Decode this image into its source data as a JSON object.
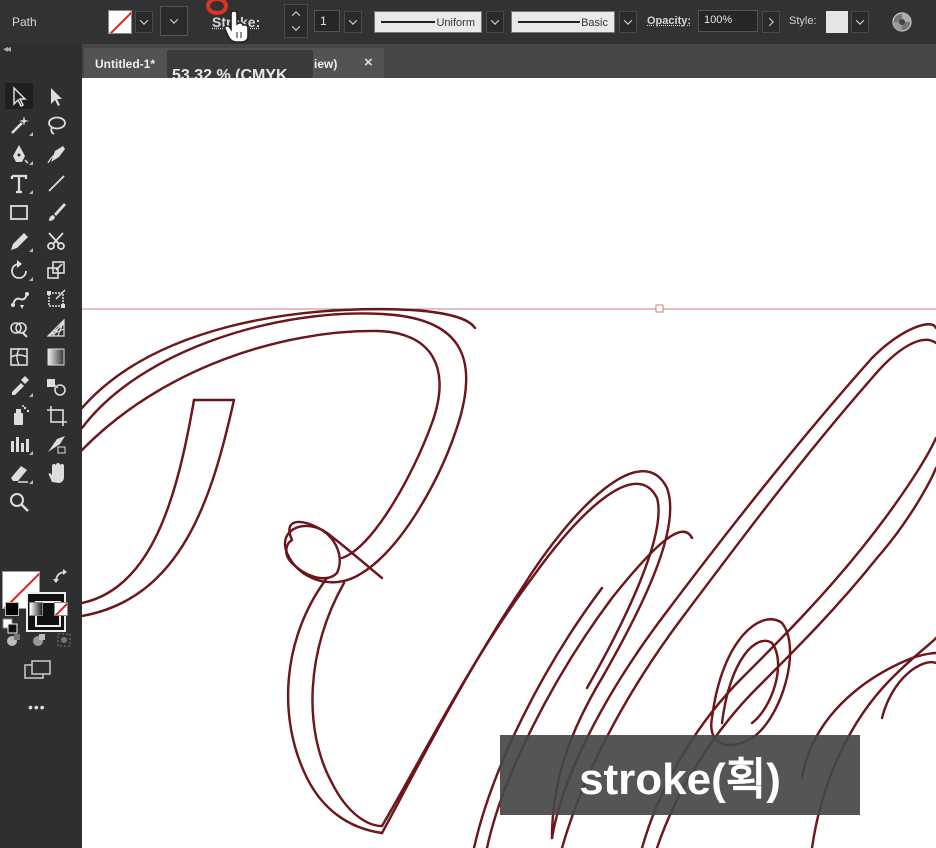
{
  "control_bar": {
    "selection_type": "Path",
    "stroke_label": "Stroke:",
    "stroke_weight": "1",
    "variable_width_profile": "Uniform",
    "brush_definition": "Basic",
    "opacity_label": "Opacity:",
    "opacity_value": "100%",
    "style_label": "Style:"
  },
  "document_tab": {
    "name": "Untitled-1*",
    "view_suffix": "iew)",
    "close_glyph": "×"
  },
  "zoom_tooltip": "53.32 % (CMYK",
  "tools": [
    "selection-tool",
    "direct-selection-tool",
    "magic-wand-tool",
    "lasso-tool",
    "pen-tool",
    "curvature-tool",
    "type-tool",
    "line-segment-tool",
    "rectangle-tool",
    "paintbrush-tool",
    "pencil-tool",
    "scissors-tool",
    "rotate-tool",
    "scale-tool",
    "puppet-warp-tool",
    "free-transform-tool",
    "shape-builder-tool",
    "perspective-grid-tool",
    "mesh-tool",
    "gradient-tool",
    "eyedropper-tool",
    "blend-tool",
    "symbol-sprayer-tool",
    "artboard-tool",
    "column-graph-tool",
    "slice-tool",
    "eraser-tool",
    "hand-tool",
    "zoom-tool"
  ],
  "more_tools_glyph": "•••",
  "colors": {
    "path_outline": "#5a1015",
    "path_inner": "#8a1a1e",
    "guide": "#c77b7b",
    "panel_bg": "#2f2f2f",
    "accent_none": "#dd2222"
  },
  "subtitle": "stroke(획)"
}
